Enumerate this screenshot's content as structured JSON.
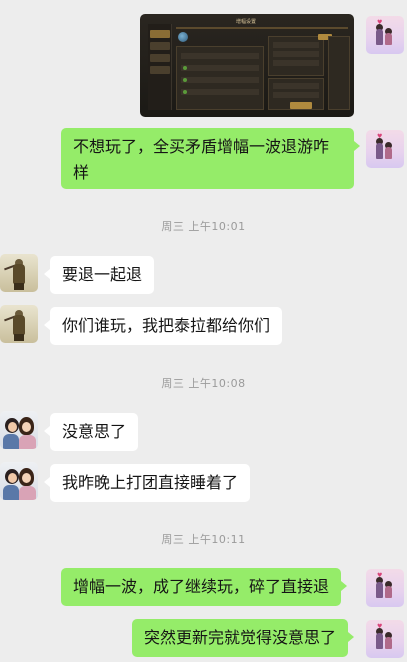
{
  "chat": {
    "messages": [
      {
        "side": "me",
        "text": "不想玩了，全买矛盾增幅一波退游咋样"
      },
      {
        "side": "other",
        "avatar": "knight-avatar",
        "text": "要退一起退"
      },
      {
        "side": "other",
        "avatar": "knight-avatar",
        "text": "你们谁玩，我把泰拉都给你们"
      },
      {
        "side": "other",
        "avatar": "couple-avatar",
        "text": "没意思了"
      },
      {
        "side": "other",
        "avatar": "couple-avatar",
        "text": "我昨晚上打团直接睡着了"
      },
      {
        "side": "me",
        "text": "增幅一波，成了继续玩，碎了直接退"
      },
      {
        "side": "me",
        "text": "突然更新完就觉得没意思了"
      }
    ],
    "timestamps": [
      "周三 上午10:01",
      "周三 上午10:08",
      "周三 上午10:11"
    ],
    "image": {
      "title": "增幅设置"
    }
  },
  "colors": {
    "background": "#ededed",
    "my_bubble": "#95ec69",
    "other_bubble": "#ffffff",
    "timestamp": "#9a9a9a"
  }
}
